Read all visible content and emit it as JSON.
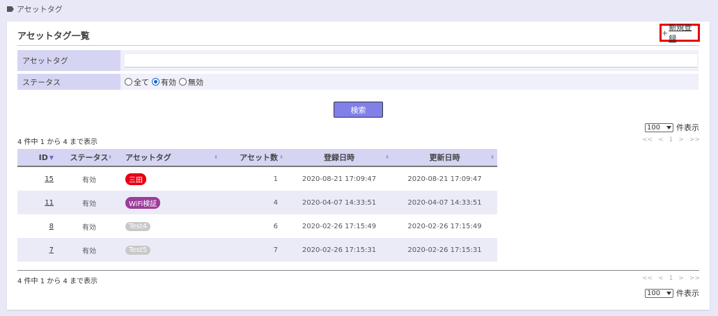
{
  "breadcrumb": {
    "label": "アセットタグ"
  },
  "card": {
    "title": "アセットタグ一覧",
    "new_button": "新規登録",
    "new_plus": "+"
  },
  "filters": {
    "tag": {
      "label": "アセットタグ",
      "value": ""
    },
    "status": {
      "label": "ステータス",
      "options": [
        {
          "label": "全て",
          "checked": false
        },
        {
          "label": "有効",
          "checked": true
        },
        {
          "label": "無効",
          "checked": false
        }
      ]
    }
  },
  "search_button": "検索",
  "page_size": {
    "value": "100",
    "suffix": "件表示"
  },
  "summary": "4 件中 1 から 4 まで表示",
  "pager": {
    "first": "<<",
    "prev": "<",
    "page": "1",
    "next": ">",
    "last": ">>"
  },
  "columns": {
    "id": "ID",
    "status": "ステータス",
    "tag": "アセットタグ",
    "count": "アセット数",
    "registered": "登録日時",
    "updated": "更新日時"
  },
  "rows": [
    {
      "id": "15",
      "status": "有効",
      "tag": {
        "label": "三田",
        "color": "#e60012"
      },
      "count": "1",
      "registered": "2020-08-21 17:09:47",
      "updated": "2020-08-21 17:09:47"
    },
    {
      "id": "11",
      "status": "有効",
      "tag": {
        "label": "WiFi検証",
        "color": "#9c3d99"
      },
      "count": "4",
      "registered": "2020-04-07 14:33:51",
      "updated": "2020-04-07 14:33:51"
    },
    {
      "id": "8",
      "status": "有効",
      "tag": {
        "label": "Test4",
        "color": "#c8c8c8"
      },
      "count": "6",
      "registered": "2020-02-26 17:15:49",
      "updated": "2020-02-26 17:15:49"
    },
    {
      "id": "7",
      "status": "有効",
      "tag": {
        "label": "Test5",
        "color": "#c8c8c8"
      },
      "count": "7",
      "registered": "2020-02-26 17:15:31",
      "updated": "2020-02-26 17:15:31"
    }
  ]
}
